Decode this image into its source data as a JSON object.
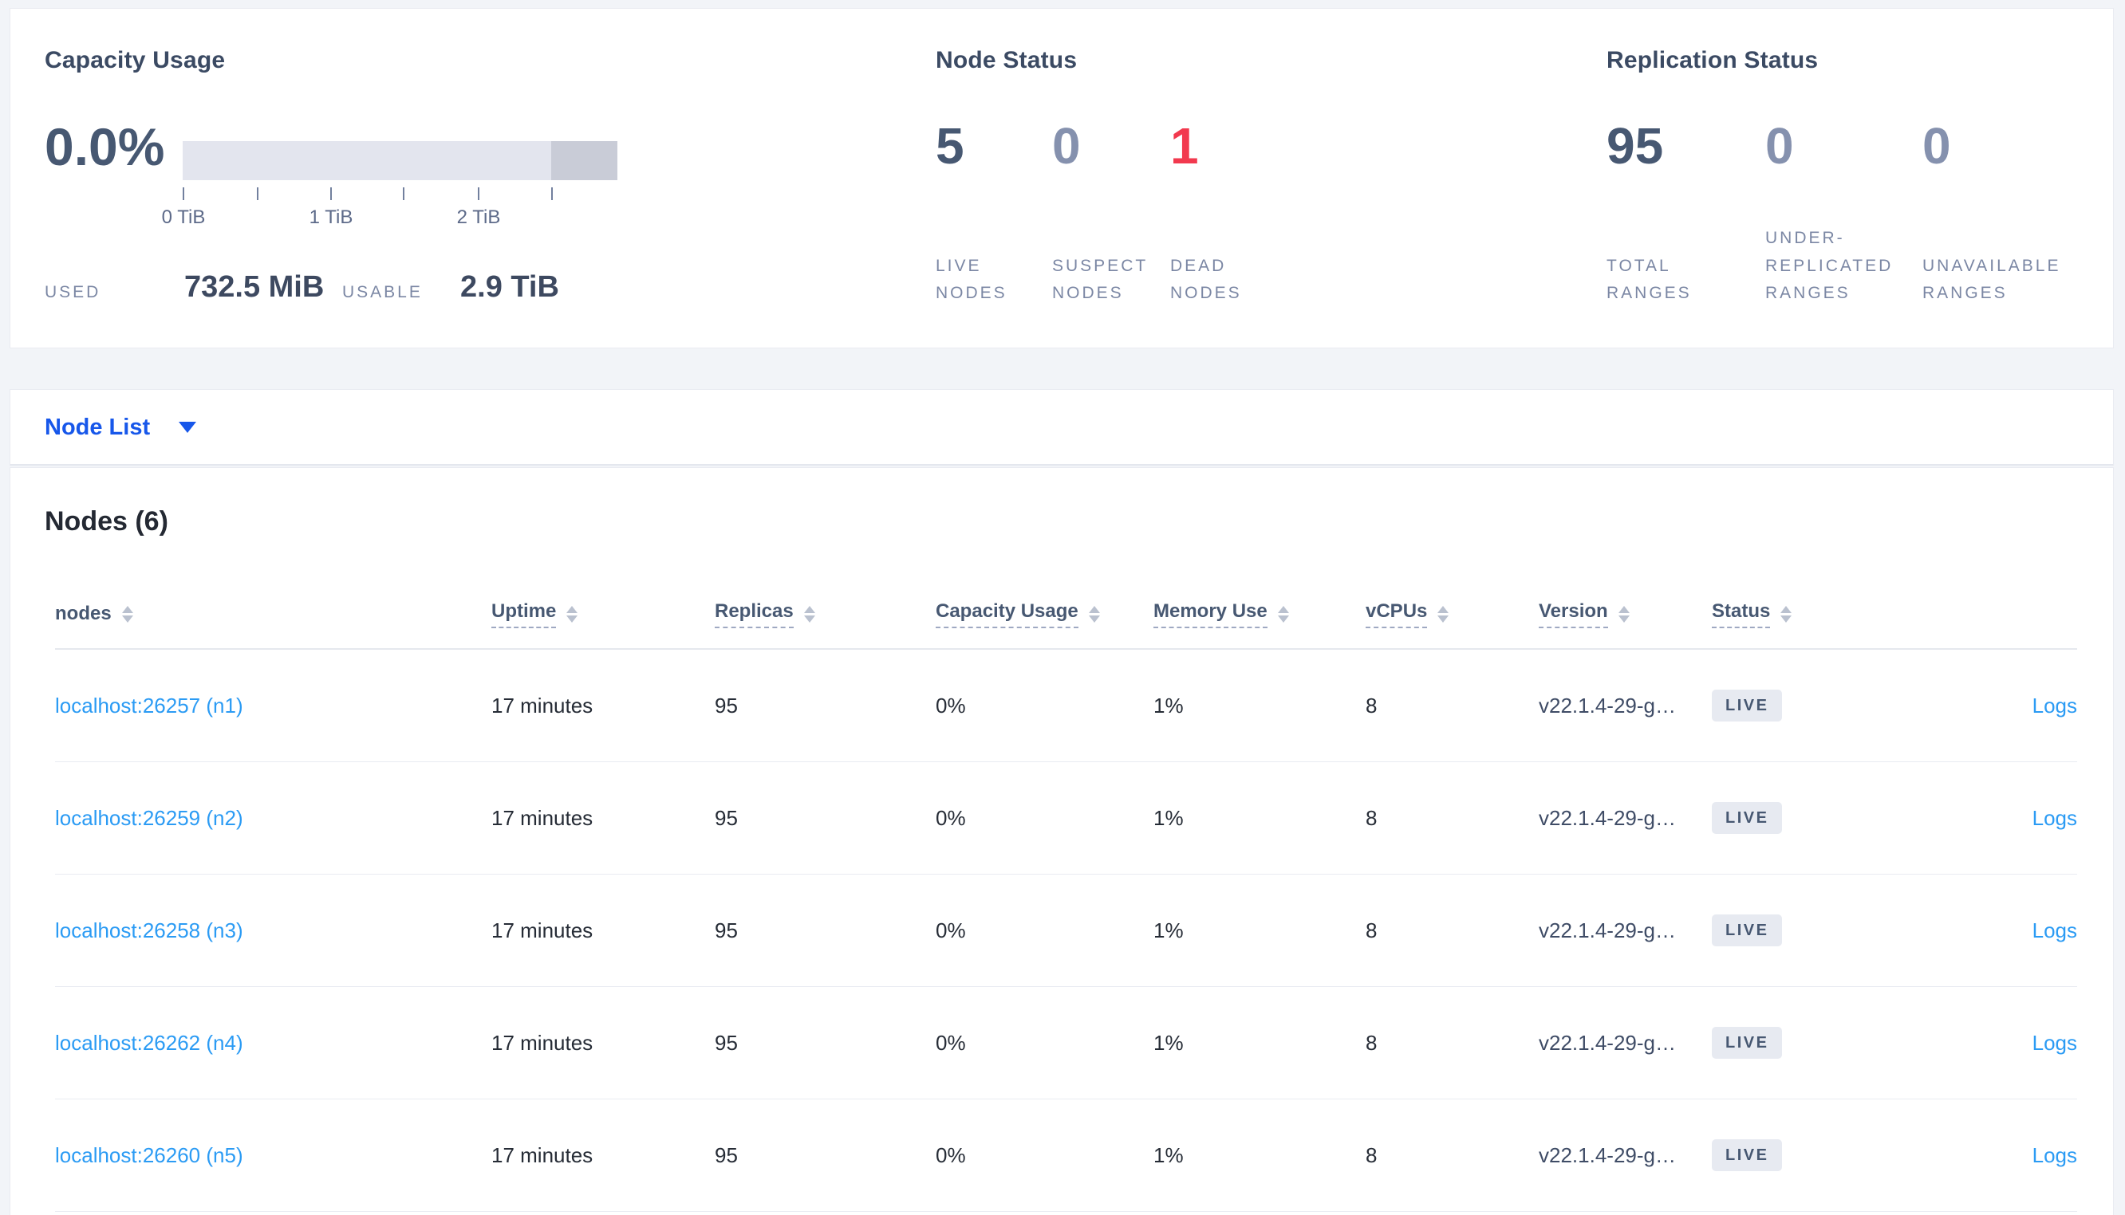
{
  "colors": {
    "accent_blue": "#1757ea",
    "link_blue": "#2b9bf4",
    "danger_red": "#f2394e",
    "slate_dark": "#475872",
    "slate_muted": "#8591ae",
    "label_gray": "#7b87a4",
    "badge_bg": "#e7eaf1",
    "bar_light": "#e3e5ee",
    "bar_dark": "#c9ccd7"
  },
  "summary": {
    "capacity": {
      "title": "Capacity Usage",
      "percent": "0.0%",
      "used_label": "USED",
      "used_value": "732.5 MiB",
      "usable_label": "USABLE",
      "usable_value": "2.9 TiB",
      "axis_ticks": [
        "0 TiB",
        "1 TiB",
        "2 TiB"
      ],
      "bar": {
        "light_pct": 84.8,
        "dark_pct": 15.2
      }
    },
    "node_status": {
      "title": "Node Status",
      "metrics": [
        {
          "value": "5",
          "label": "LIVE\nNODES",
          "tone": "dark"
        },
        {
          "value": "0",
          "label": "SUSPECT\nNODES",
          "tone": "muted"
        },
        {
          "value": "1",
          "label": "DEAD\nNODES",
          "tone": "danger"
        }
      ]
    },
    "replication": {
      "title": "Replication Status",
      "metrics": [
        {
          "value": "95",
          "label": "TOTAL\nRANGES",
          "tone": "dark"
        },
        {
          "value": "0",
          "label": "UNDER-\nREPLICATED\nRANGES",
          "tone": "muted"
        },
        {
          "value": "0",
          "label": "UNAVAILABLE\nRANGES",
          "tone": "muted"
        }
      ]
    }
  },
  "view_selector": {
    "label": "Node List"
  },
  "nodes_section": {
    "heading": "Nodes (6)",
    "columns": [
      {
        "label": "nodes"
      },
      {
        "label": "Uptime"
      },
      {
        "label": "Replicas"
      },
      {
        "label": "Capacity Usage"
      },
      {
        "label": "Memory Use"
      },
      {
        "label": "vCPUs"
      },
      {
        "label": "Version"
      },
      {
        "label": "Status"
      }
    ],
    "rows": [
      {
        "node": "localhost:26257 (n1)",
        "uptime": "17 minutes",
        "replicas": "95",
        "capacity_usage": "0%",
        "memory_use": "1%",
        "vcpus": "8",
        "version": "v22.1.4-29-g…",
        "status": "LIVE",
        "logs_label": "Logs"
      },
      {
        "node": "localhost:26259 (n2)",
        "uptime": "17 minutes",
        "replicas": "95",
        "capacity_usage": "0%",
        "memory_use": "1%",
        "vcpus": "8",
        "version": "v22.1.4-29-g…",
        "status": "LIVE",
        "logs_label": "Logs"
      },
      {
        "node": "localhost:26258 (n3)",
        "uptime": "17 minutes",
        "replicas": "95",
        "capacity_usage": "0%",
        "memory_use": "1%",
        "vcpus": "8",
        "version": "v22.1.4-29-g…",
        "status": "LIVE",
        "logs_label": "Logs"
      },
      {
        "node": "localhost:26262 (n4)",
        "uptime": "17 minutes",
        "replicas": "95",
        "capacity_usage": "0%",
        "memory_use": "1%",
        "vcpus": "8",
        "version": "v22.1.4-29-g…",
        "status": "LIVE",
        "logs_label": "Logs"
      },
      {
        "node": "localhost:26260 (n5)",
        "uptime": "17 minutes",
        "replicas": "95",
        "capacity_usage": "0%",
        "memory_use": "1%",
        "vcpus": "8",
        "version": "v22.1.4-29-g…",
        "status": "LIVE",
        "logs_label": "Logs"
      }
    ]
  }
}
